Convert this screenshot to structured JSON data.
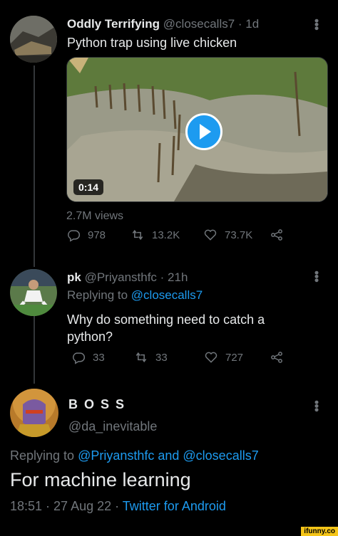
{
  "tweet1": {
    "name": "Oddly Terrifying",
    "handle": "@closecalls7 · 1d",
    "text": "Python trap using live chicken",
    "video_duration": "0:14",
    "views": "2.7M views",
    "replies": "978",
    "retweets": "13.2K",
    "likes": "73.7K"
  },
  "tweet2": {
    "name": "pk",
    "handle": "@Priyansthfc · 21h",
    "replying_prefix": "Replying to ",
    "replying_to": "@closecalls7",
    "text_line1": "Why do something need to catch a",
    "text_line2": "python?",
    "replies": "33",
    "retweets": "33",
    "likes": "727"
  },
  "tweet3": {
    "name": "B O S S",
    "handle": "@da_inevitable",
    "replying_prefix": "Replying to ",
    "replying_to": "@Priyansthfc and @closecalls7",
    "text": "For machine learning",
    "time": "18:51 · 27 Aug 22 · ",
    "source": "Twitter for Android"
  },
  "watermark": "ifunny.co",
  "icons": [
    "reply-icon",
    "retweet-icon",
    "like-icon",
    "share-icon",
    "more-icon",
    "play-icon"
  ],
  "colors": {
    "background": "#000000",
    "link": "#1d9bf0",
    "muted": "#71767b"
  }
}
